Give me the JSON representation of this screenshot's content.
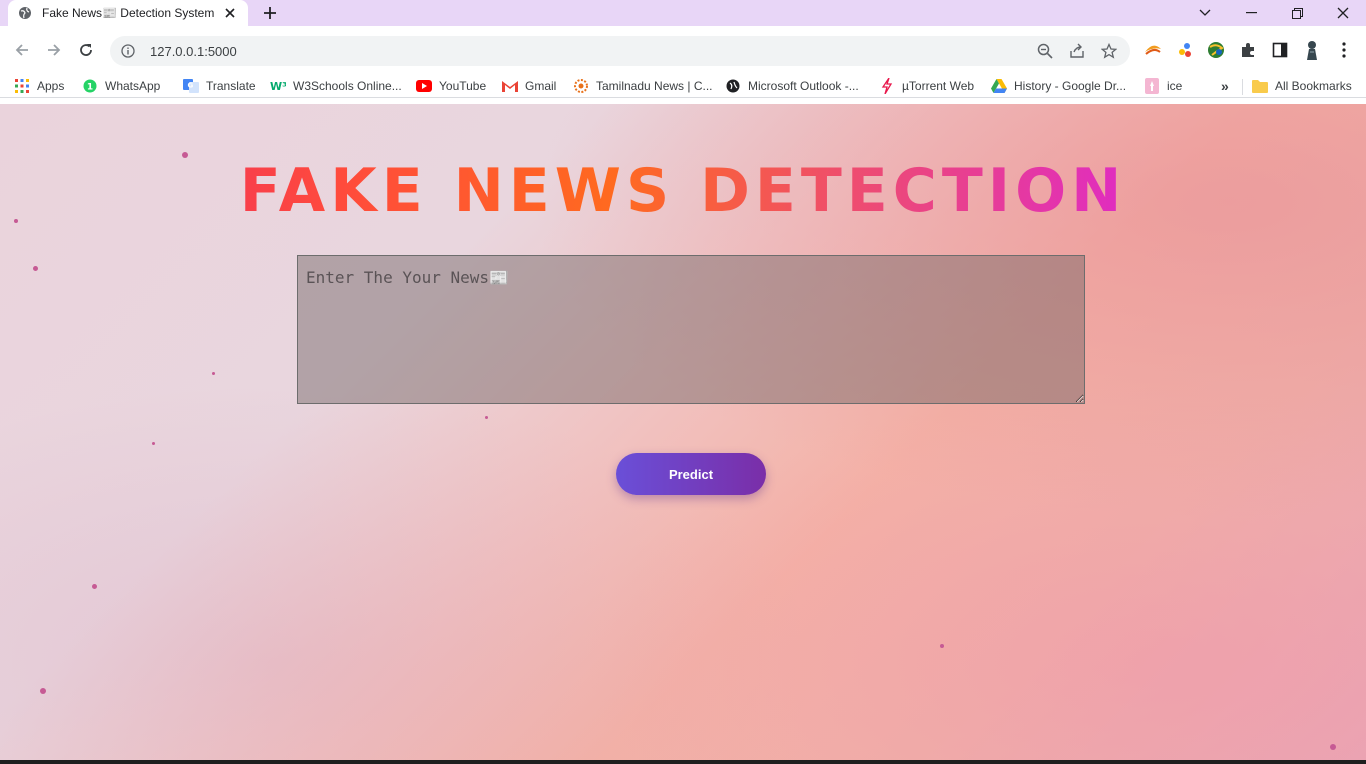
{
  "browser": {
    "tab": {
      "title": "Fake News📰 Detection System"
    },
    "new_tab_label": "+",
    "address": {
      "url": "127.0.0.1:5000"
    },
    "bookmarks": [
      {
        "label": "Apps",
        "icon": "apps-grid-icon"
      },
      {
        "label": "WhatsApp",
        "icon": "whatsapp-icon"
      },
      {
        "label": "Translate",
        "icon": "google-translate-icon"
      },
      {
        "label": "W3Schools Online...",
        "icon": "w3schools-icon"
      },
      {
        "label": "YouTube",
        "icon": "youtube-icon"
      },
      {
        "label": "Gmail",
        "icon": "gmail-icon"
      },
      {
        "label": "Tamilnadu News | C...",
        "icon": "news-site-icon"
      },
      {
        "label": "Microsoft Outlook -...",
        "icon": "outlook-icon"
      },
      {
        "label": "µTorrent Web",
        "icon": "utorrent-icon"
      },
      {
        "label": "History - Google Dr...",
        "icon": "google-drive-icon"
      },
      {
        "label": "ice",
        "icon": "ice-icon"
      }
    ],
    "bookmarks_overflow": "»",
    "all_bookmarks": {
      "label": "All Bookmarks",
      "icon": "folder-icon"
    }
  },
  "page": {
    "title": "FAKE NEWS DETECTION",
    "news_input": {
      "placeholder": "Enter The Your News📰",
      "value": ""
    },
    "predict_label": "Predict"
  },
  "colors": {
    "title_gradient": [
      "#e8226e",
      "#ff6a1f",
      "#e02dbf"
    ],
    "button_gradient": [
      "#6a4fd8",
      "#7a2ea8"
    ],
    "tab_strip": "#e8d6f7"
  }
}
